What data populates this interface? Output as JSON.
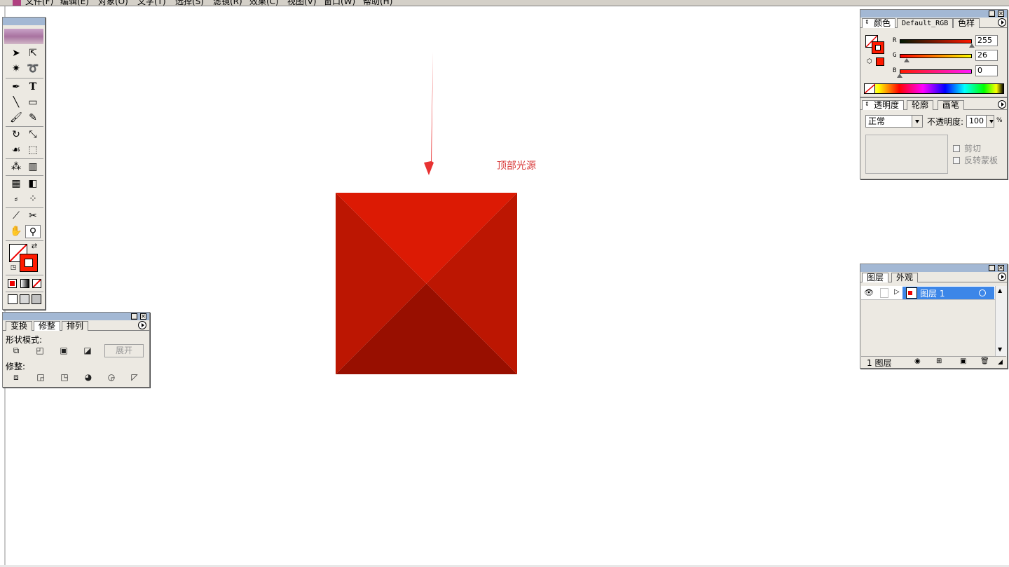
{
  "menubar": {
    "items": [
      "文件(F)",
      "编辑(E)",
      "对象(O)",
      "文字(T)",
      "选择(S)",
      "滤镜(R)",
      "效果(C)",
      "视图(V)",
      "窗口(W)",
      "帮助(H)"
    ]
  },
  "canvas": {
    "annotation_label": "顶部光源",
    "colors": {
      "pyramid_top": "#dc1a04",
      "pyramid_left": "#bc1602",
      "pyramid_right": "#bc1602",
      "pyramid_bottom": "#980f00",
      "arrow": "#e83232"
    }
  },
  "toolbox": {
    "tools": [
      "selection-arrow-icon",
      "direct-selection-icon",
      "magic-wand-icon",
      "lasso-icon",
      "pen-icon",
      "type-icon",
      "line-icon",
      "rectangle-icon",
      "paintbrush-icon",
      "pencil-icon",
      "rotate-icon",
      "scale-icon",
      "warp-icon",
      "free-transform-icon",
      "symbol-sprayer-icon",
      "graph-icon",
      "mesh-icon",
      "gradient-icon",
      "eyedropper-icon",
      "blend-icon",
      "slice-icon",
      "scissors-icon",
      "hand-icon",
      "zoom-icon"
    ]
  },
  "pathfinder": {
    "tabs": [
      "变换",
      "修整",
      "排列"
    ],
    "shape_modes_label": "形状模式:",
    "expand_label": "展开",
    "pathfinders_label": "修整:"
  },
  "color_panel": {
    "tabs": [
      "颜色",
      "Default_RGB",
      "色样"
    ],
    "channels": [
      {
        "label": "R",
        "value": "255",
        "fraction": 1.0
      },
      {
        "label": "G",
        "value": "26",
        "fraction": 0.1
      },
      {
        "label": "B",
        "value": "0",
        "fraction": 0.0
      }
    ],
    "fill_color": "#ff1a00"
  },
  "transparency_panel": {
    "tabs": [
      "透明度",
      "轮廓",
      "画笔"
    ],
    "blend_mode": "正常",
    "opacity_label": "不透明度:",
    "opacity_value": "100",
    "opacity_unit": "%",
    "clip_label": "剪切",
    "invert_mask_label": "反转蒙板"
  },
  "layers_panel": {
    "tabs": [
      "图层",
      "外观"
    ],
    "layer_name": "图层 1",
    "footer_count": "1 图层"
  }
}
